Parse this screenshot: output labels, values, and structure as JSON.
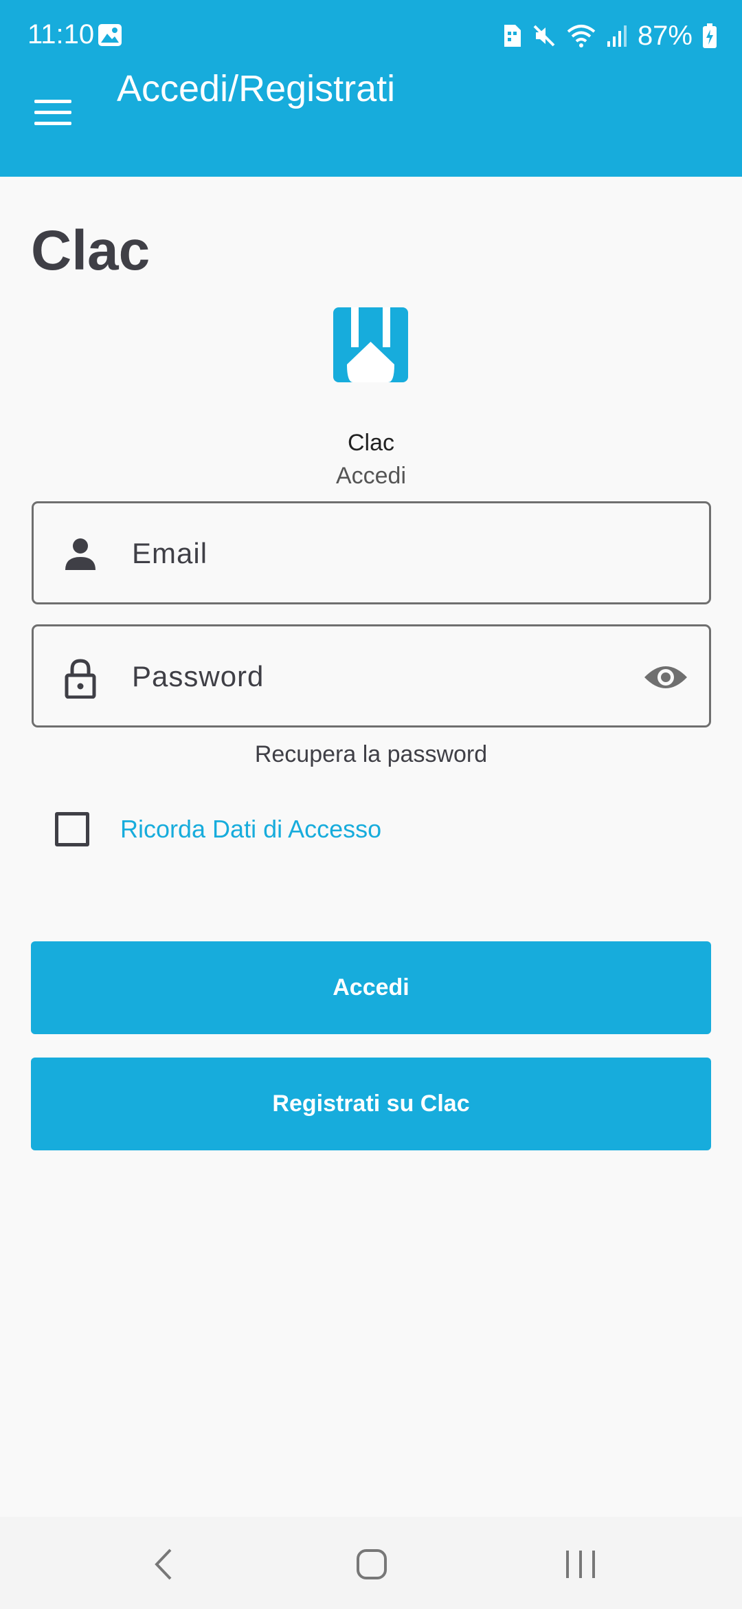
{
  "status_bar": {
    "time": "11:10",
    "battery": "87%",
    "icons": [
      "gallery-icon",
      "sim-icon",
      "mute-icon",
      "wifi-icon",
      "signal-icon",
      "battery-charging-icon"
    ]
  },
  "app_bar": {
    "title": "Accedi/Registrati",
    "menu_icon": "hamburger-menu-icon"
  },
  "page": {
    "heading": "Clac",
    "brand_name": "Clac",
    "brand_subtitle": "Accedi"
  },
  "form": {
    "email": {
      "placeholder": "Email",
      "value": "",
      "icon": "person-icon"
    },
    "password": {
      "placeholder": "Password",
      "value": "",
      "icon": "lock-icon",
      "toggle_icon": "eye-icon"
    },
    "recover_label": "Recupera la password",
    "remember_label": "Ricorda Dati di Accesso",
    "remember_checked": false
  },
  "buttons": {
    "login_label": "Accedi",
    "register_label": "Registrati su Clac"
  },
  "nav_bar": {
    "icons": [
      "back-icon",
      "home-icon",
      "recents-icon"
    ]
  },
  "colors": {
    "primary": "#17acdc",
    "text": "#3f3f46",
    "background": "#f9f9f9"
  }
}
